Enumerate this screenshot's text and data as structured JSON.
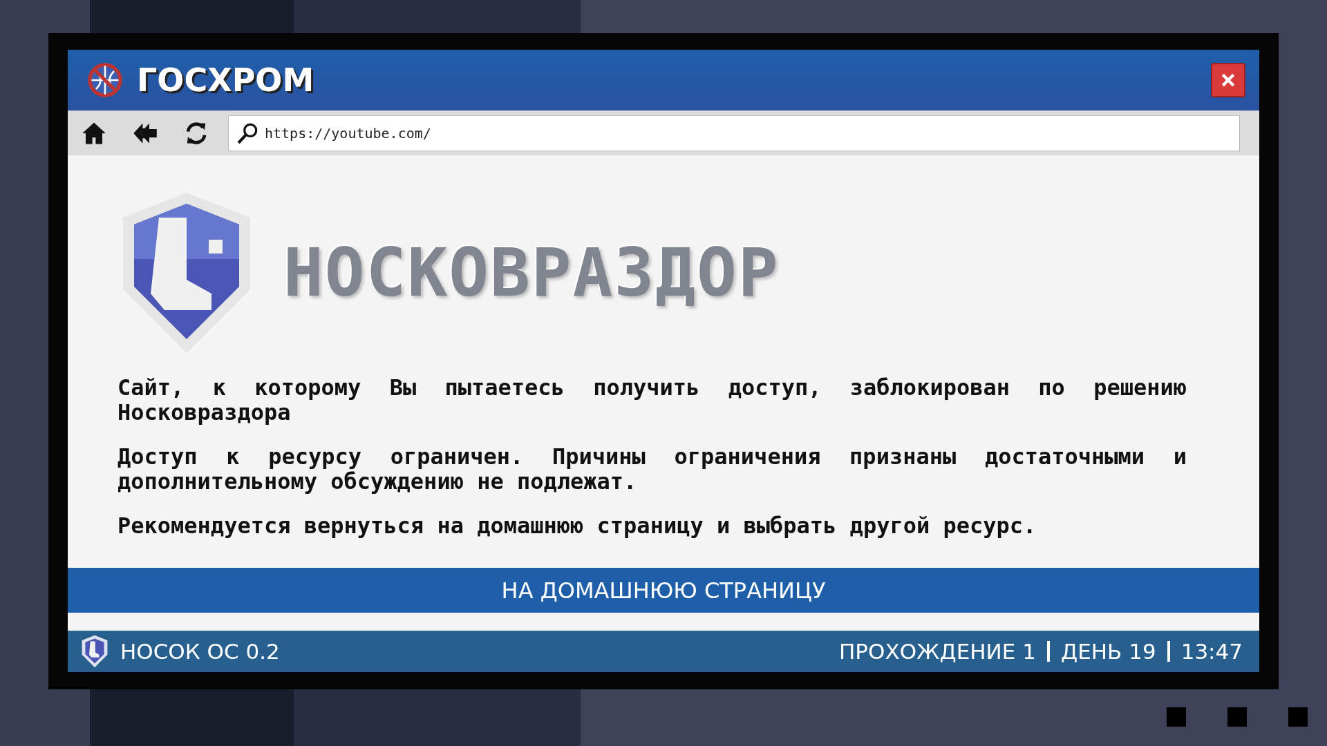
{
  "window": {
    "title": "ГОСХРОМ"
  },
  "toolbar": {
    "address": "https://youtube.com/"
  },
  "page": {
    "brand": "НОСКОВРАЗДОР",
    "paragraphs": [
      "Сайт, к которому Вы пытаетесь получить доступ, заблокирован по решению Носковраздора",
      "Доступ к ресурсу ограничен. Причины ограничения признаны достаточными и дополнительному обсуждению не подлежат.",
      "Рекомендуется вернуться на домашнюю страницу и выбрать другой ресурс."
    ],
    "home_button": "НА ДОМАШНЮЮ СТРАНИЦУ"
  },
  "status_bar": {
    "os": "НОСОК ОС 0.2",
    "items": [
      "ПРОХОЖДЕНИЕ 1",
      "ДЕНЬ 19",
      "13:47"
    ]
  }
}
